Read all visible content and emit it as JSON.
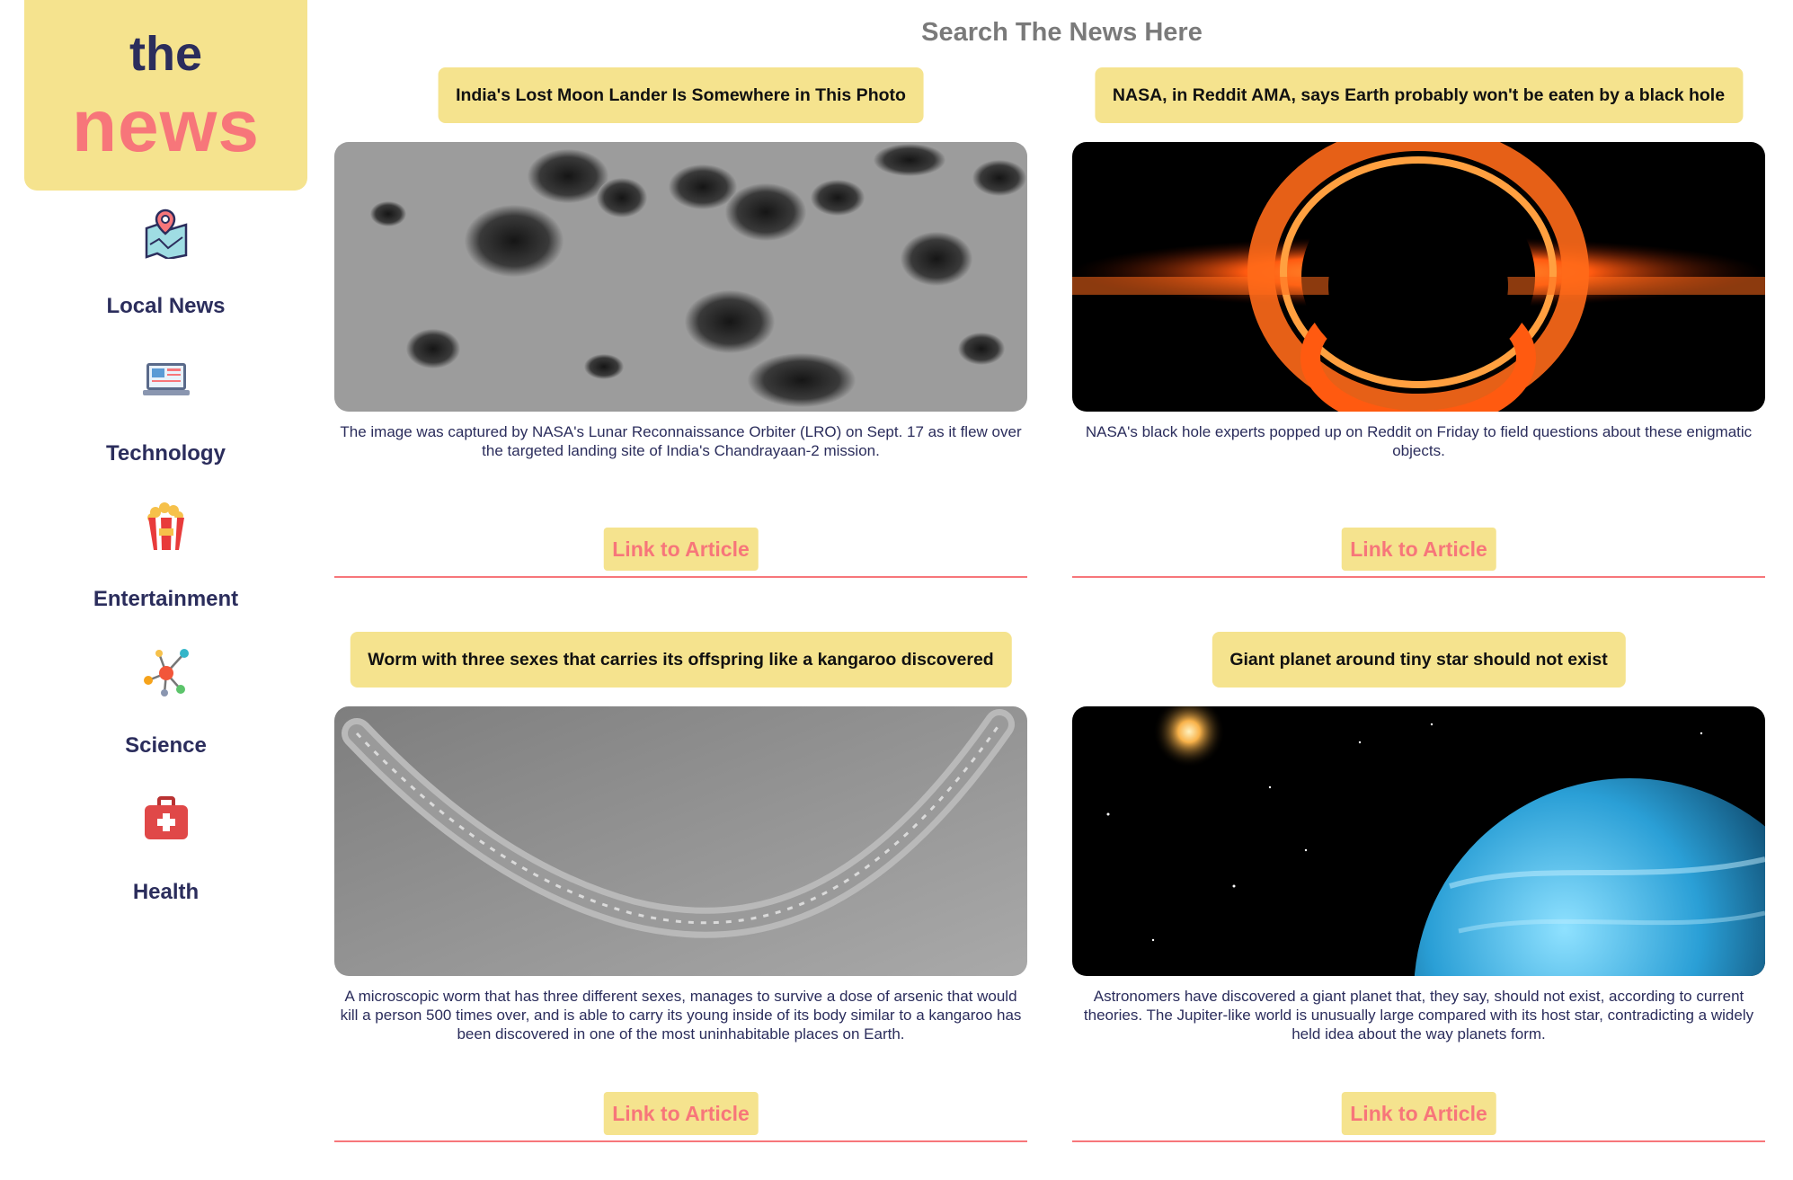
{
  "logo": {
    "line1": "the",
    "line2": "news"
  },
  "nav": [
    {
      "label": "Local News",
      "icon": "map-pin-icon"
    },
    {
      "label": "Technology",
      "icon": "laptop-icon"
    },
    {
      "label": "Entertainment",
      "icon": "popcorn-icon"
    },
    {
      "label": "Science",
      "icon": "molecule-icon"
    },
    {
      "label": "Health",
      "icon": "first-aid-kit-icon"
    }
  ],
  "search": {
    "title": "Search The News Here"
  },
  "articles": [
    {
      "title": "India's Lost Moon Lander Is Somewhere in This Photo",
      "image": "moon-surface-photo",
      "description": "The image was captured by NASA's Lunar Reconnaissance Orbiter (LRO) on Sept. 17 as it flew over the targeted landing site of India's Chandrayaan-2 mission.",
      "link_label": "Link to Article"
    },
    {
      "title": "NASA, in Reddit AMA, says Earth probably won't be eaten by a black hole",
      "image": "black-hole-photo",
      "description": "NASA's black hole experts popped up on Reddit on Friday to field questions about these enigmatic objects.",
      "link_label": "Link to Article"
    },
    {
      "title": "Worm with three sexes that carries its offspring like a kangaroo discovered",
      "image": "worm-photo",
      "description": "A microscopic worm that has three different sexes, manages to survive a dose of arsenic that would kill a person 500 times over, and is able to carry its young inside of its body similar to a kangaroo has been discovered in one of the most uninhabitable places on Earth.",
      "link_label": "Link to Article"
    },
    {
      "title": "Giant planet around tiny star should not exist",
      "image": "planet-photo",
      "description": "Astronomers have discovered a giant planet that, they say, should not exist, according to current theories. The Jupiter-like world is unusually large compared with its host star, contradicting a widely held idea about the way planets form.",
      "link_label": "Link to Article"
    }
  ],
  "colors": {
    "accent_yellow": "#f5e38e",
    "accent_coral": "#f7767a",
    "text_navy": "#2b2d5c"
  }
}
